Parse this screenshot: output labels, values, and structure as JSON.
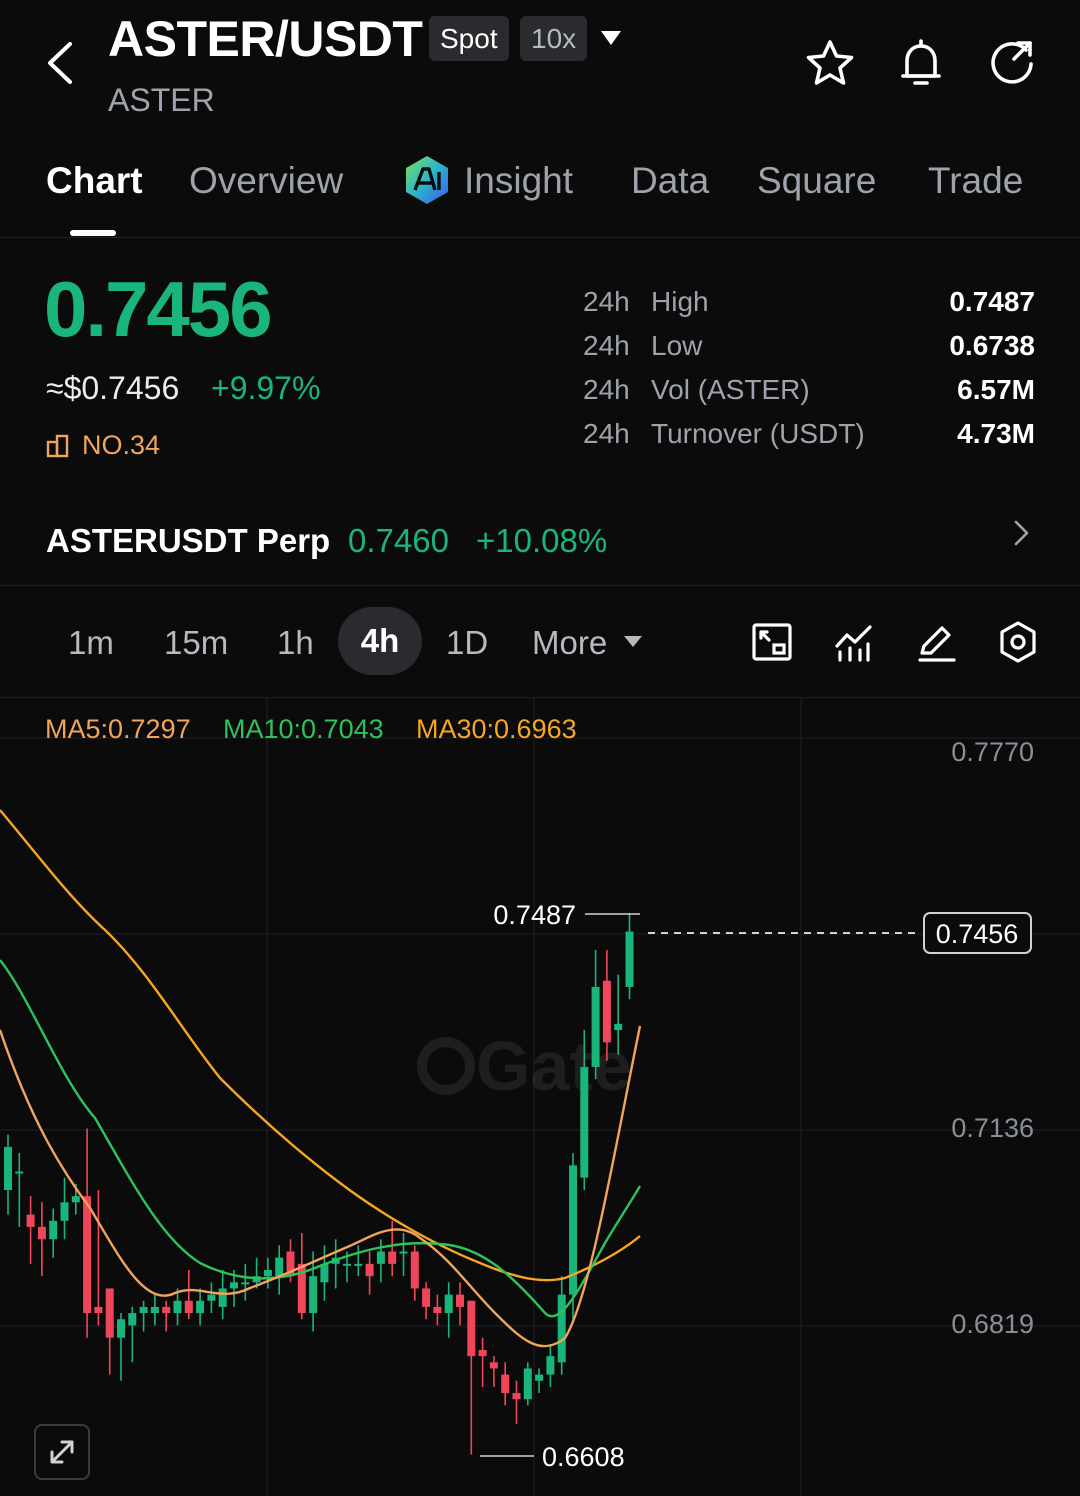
{
  "header": {
    "pair": "ASTER/USDT",
    "base": "ASTER",
    "market_badge": "Spot",
    "leverage_badge": "10x"
  },
  "tabs": [
    {
      "label": "Chart",
      "active": true
    },
    {
      "label": "Overview"
    },
    {
      "label": "Insight"
    },
    {
      "label": "Data"
    },
    {
      "label": "Square"
    },
    {
      "label": "Trade"
    }
  ],
  "price": {
    "last": "0.7456",
    "usd": "≈$0.7456",
    "change": "+9.97%",
    "rank": "NO.34"
  },
  "stats": [
    {
      "period": "24h",
      "label": "High",
      "value": "0.7487"
    },
    {
      "period": "24h",
      "label": "Low",
      "value": "0.6738"
    },
    {
      "period": "24h",
      "label": "Vol (ASTER)",
      "value": "6.57M"
    },
    {
      "period": "24h",
      "label": "Turnover (USDT)",
      "value": "4.73M"
    }
  ],
  "perp": {
    "name": "ASTERUSDT Perp",
    "price": "0.7460",
    "change": "+10.08%"
  },
  "intervals": [
    "1m",
    "15m",
    "1h",
    "4h",
    "1D",
    "More"
  ],
  "active_interval": "4h",
  "colors": {
    "up": "#1ab57a",
    "down": "#f0465a",
    "ma5": "#f0a45c",
    "ma10": "#2fc25b",
    "ma30": "#f5a623"
  },
  "chart_data": {
    "type": "candlestick",
    "ma_labels": [
      "MA5:0.7297",
      "MA10:0.7043",
      "MA30:0.6963"
    ],
    "y_ticks": [
      "0.7770",
      "0.7136",
      "0.6819"
    ],
    "y_ticks_values": [
      0.777,
      0.7136,
      0.6819
    ],
    "current_price": "0.7456",
    "high_marker": "0.7487",
    "low_marker": "0.6608",
    "watermark": "Gate",
    "candles": [
      [
        0.704,
        0.711,
        0.7,
        0.713
      ],
      [
        0.707,
        0.707,
        0.698,
        0.71
      ],
      [
        0.7,
        0.698,
        0.692,
        0.703
      ],
      [
        0.698,
        0.696,
        0.69,
        0.702
      ],
      [
        0.696,
        0.699,
        0.693,
        0.701
      ],
      [
        0.699,
        0.702,
        0.696,
        0.706
      ],
      [
        0.702,
        0.703,
        0.7,
        0.705
      ],
      [
        0.703,
        0.684,
        0.68,
        0.714
      ],
      [
        0.685,
        0.684,
        0.682,
        0.704
      ],
      [
        0.688,
        0.68,
        0.674,
        0.688
      ],
      [
        0.68,
        0.683,
        0.673,
        0.684
      ],
      [
        0.682,
        0.684,
        0.676,
        0.685
      ],
      [
        0.684,
        0.685,
        0.681,
        0.686
      ],
      [
        0.684,
        0.685,
        0.682,
        0.687
      ],
      [
        0.685,
        0.684,
        0.681,
        0.686
      ],
      [
        0.684,
        0.686,
        0.682,
        0.688
      ],
      [
        0.686,
        0.684,
        0.683,
        0.691
      ],
      [
        0.684,
        0.686,
        0.682,
        0.688
      ],
      [
        0.686,
        0.687,
        0.684,
        0.689
      ],
      [
        0.685,
        0.688,
        0.683,
        0.691
      ],
      [
        0.688,
        0.689,
        0.685,
        0.691
      ],
      [
        0.689,
        0.689,
        0.686,
        0.692
      ],
      [
        0.689,
        0.69,
        0.688,
        0.693
      ],
      [
        0.69,
        0.691,
        0.688,
        0.693
      ],
      [
        0.69,
        0.693,
        0.687,
        0.695
      ],
      [
        0.694,
        0.69,
        0.689,
        0.696
      ],
      [
        0.692,
        0.684,
        0.683,
        0.697
      ],
      [
        0.684,
        0.69,
        0.681,
        0.694
      ],
      [
        0.689,
        0.692,
        0.686,
        0.695
      ],
      [
        0.692,
        0.693,
        0.688,
        0.696
      ],
      [
        0.692,
        0.692,
        0.689,
        0.694
      ],
      [
        0.692,
        0.692,
        0.69,
        0.695
      ],
      [
        0.692,
        0.69,
        0.687,
        0.694
      ],
      [
        0.692,
        0.694,
        0.689,
        0.696
      ],
      [
        0.694,
        0.692,
        0.69,
        0.699
      ],
      [
        0.694,
        0.694,
        0.69,
        0.697
      ],
      [
        0.694,
        0.688,
        0.686,
        0.695
      ],
      [
        0.688,
        0.685,
        0.683,
        0.689
      ],
      [
        0.685,
        0.684,
        0.682,
        0.687
      ],
      [
        0.684,
        0.687,
        0.68,
        0.689
      ],
      [
        0.687,
        0.685,
        0.682,
        0.689
      ],
      [
        0.686,
        0.677,
        0.661,
        0.686
      ],
      [
        0.678,
        0.677,
        0.672,
        0.68
      ],
      [
        0.676,
        0.675,
        0.672,
        0.677
      ],
      [
        0.674,
        0.671,
        0.669,
        0.676
      ],
      [
        0.671,
        0.67,
        0.666,
        0.673
      ],
      [
        0.67,
        0.675,
        0.669,
        0.676
      ],
      [
        0.673,
        0.674,
        0.671,
        0.675
      ],
      [
        0.674,
        0.677,
        0.672,
        0.679
      ],
      [
        0.676,
        0.687,
        0.674,
        0.69
      ],
      [
        0.687,
        0.708,
        0.683,
        0.71
      ],
      [
        0.706,
        0.724,
        0.704,
        0.73
      ],
      [
        0.724,
        0.737,
        0.722,
        0.743
      ],
      [
        0.738,
        0.728,
        0.725,
        0.743
      ],
      [
        0.73,
        0.731,
        0.726,
        0.739
      ],
      [
        0.737,
        0.746,
        0.735,
        0.749
      ]
    ]
  }
}
